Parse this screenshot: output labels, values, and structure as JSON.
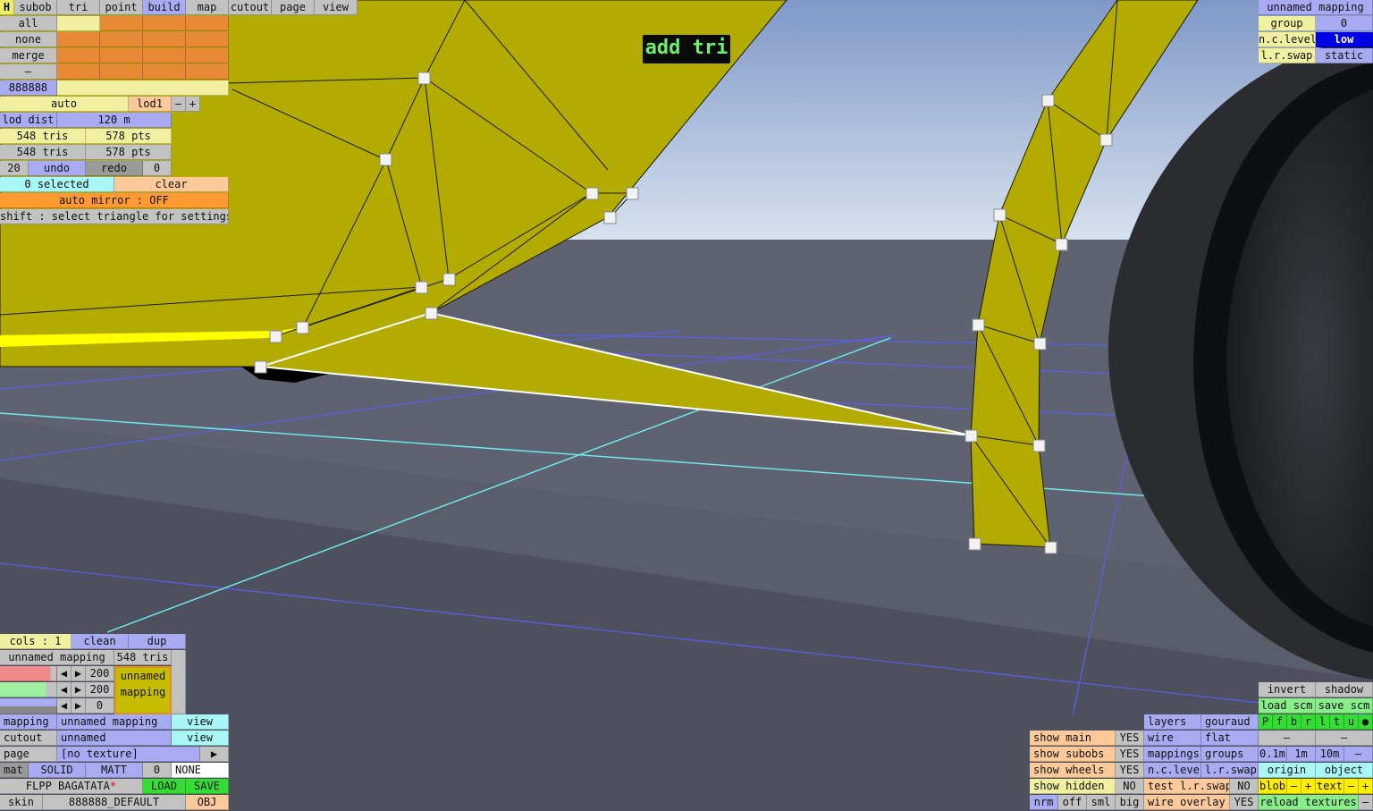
{
  "mode_label": "add tri",
  "top_tabs": [
    "H",
    "subob",
    "tri",
    "point",
    "build",
    "map",
    "cutout",
    "page",
    "view"
  ],
  "select_rows": [
    "all",
    "none",
    "merge",
    "–"
  ],
  "color_code": "888888",
  "lod": {
    "auto": "auto",
    "lod1": "lod1",
    "minus": "–",
    "plus": "+",
    "dist_label": "lod dist",
    "dist_value": "120 m"
  },
  "stats": {
    "tris_a": "548 tris",
    "pts_a": "578 pts",
    "tris_b": "548 tris",
    "pts_b": "578 pts"
  },
  "undo_row": {
    "count": "20",
    "undo": "undo",
    "redo": "redo",
    "zero": "0"
  },
  "selection": {
    "selected": "0 selected",
    "clear": "clear"
  },
  "mirror": "auto mirror : OFF",
  "hint": "shift : select triangle for settings",
  "mapping_top": {
    "title": "unnamed mapping",
    "group_label": "group",
    "group_value": "0",
    "nc_label": "n.c.level",
    "nc_value": "low",
    "lr_label": "l.r.swap",
    "lr_value": "static"
  },
  "cols_row": {
    "cols": "cols : 1",
    "clean": "clean",
    "dup": "dup"
  },
  "mapping_info": {
    "name": "unnamed mapping",
    "tris": "548 tris"
  },
  "sliders": {
    "r": "200",
    "g": "200",
    "b": "0",
    "swatch_line1": "unnamed",
    "swatch_line2": "mapping"
  },
  "mat_rows": {
    "mapping_label": "mapping",
    "mapping_value": "unnamed mapping",
    "mapping_view": "view",
    "cutout_label": "cutout",
    "cutout_value": "unnamed",
    "cutout_view": "view",
    "page_label": "page",
    "page_value": "[no texture]",
    "page_arrow": "▶",
    "mat_label": "mat",
    "solid": "SOLID",
    "matt": "MATT",
    "mat_zero": "0",
    "none": "NONE",
    "file_name": "FLPP BAGATATA",
    "file_star": "*",
    "load": "LOAD",
    "save": "SAVE",
    "skin_label": "skin",
    "skin_value": "888888_DEFAULT",
    "obj": "OBJ"
  },
  "show_toggles": [
    {
      "label": "show main",
      "value": "YES"
    },
    {
      "label": "show subobs",
      "value": "YES"
    },
    {
      "label": "show wheels",
      "value": "YES"
    },
    {
      "label": "show hidden",
      "value": "NO"
    }
  ],
  "size_row": [
    "nrm",
    "off",
    "sml",
    "big"
  ],
  "display_modes": {
    "layers": "layers",
    "gouraud": "gouraud",
    "wire": "wire",
    "flat": "flat",
    "mappings": "mappings",
    "groups": "groups",
    "nclevel": "n.c.level",
    "lrswap": "l.r.swap",
    "test_lr": "test l.r.swap",
    "test_lr_value": "NO",
    "wire_overlay": "wire overlay",
    "wire_overlay_value": "YES"
  },
  "right_tools": {
    "invert": "invert",
    "shadow": "shadow",
    "load_scm": "load scm",
    "save_scm": "save scm",
    "letters": [
      "P",
      "f",
      "b",
      "r",
      "l",
      "t",
      "u",
      "●"
    ],
    "dash1": "–",
    "dash2": "–",
    "grid": [
      "0.1m",
      "1m",
      "10m",
      "–"
    ],
    "origin": "origin",
    "object": "object",
    "blob": "blob",
    "blob_minus": "–",
    "blob_plus": "+",
    "text": "text",
    "text_minus": "–",
    "text_plus": "+",
    "reload": "reload textures",
    "reload_minus": "–"
  },
  "colors": {
    "model": "#b3ab00",
    "sky": "#b8d0e8",
    "floor": "#5f6270",
    "grid_blue": "#5b5ef0",
    "grid_cyan": "#6ff0f0"
  }
}
